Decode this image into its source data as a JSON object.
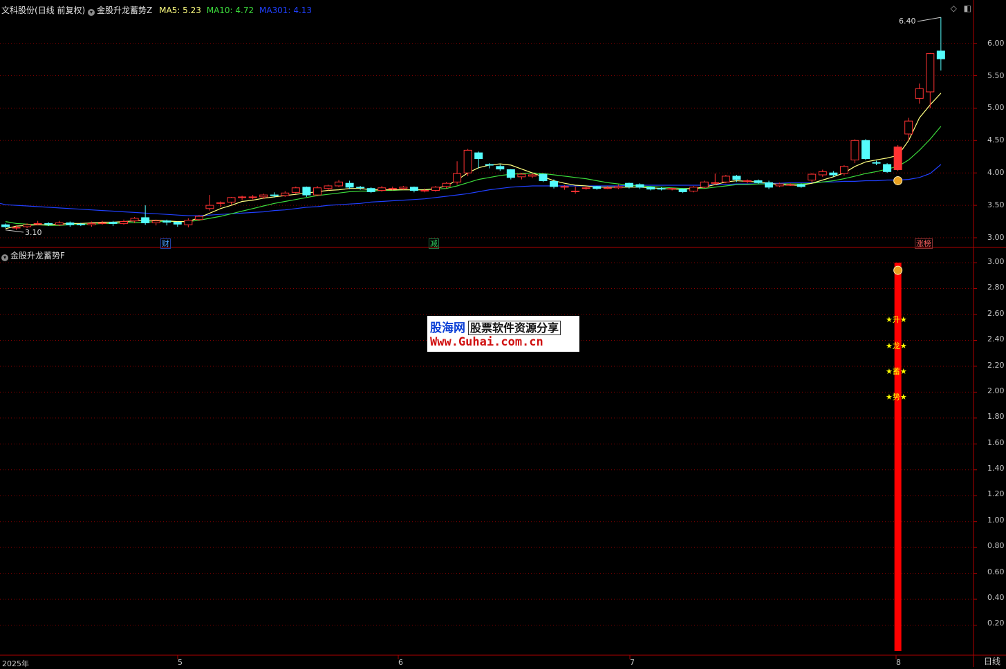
{
  "header": {
    "stock": "文科股份",
    "period": "(日线 前复权)",
    "indicator_main": "金股升龙蓄势Z",
    "ma5_label": "MA5:",
    "ma5_value": "5.23",
    "ma10_label": "MA10:",
    "ma10_value": "4.72",
    "ma301_label": "MA301:",
    "ma301_value": "4.13"
  },
  "sub_header": {
    "indicator_sub": "金股升龙蓄势F"
  },
  "colors": {
    "up": "#ff3232",
    "down": "#54fcfc",
    "ma5": "#ffff80",
    "ma10": "#3cdc3c",
    "ma301": "#2040ff",
    "grid": "#8b0000",
    "axis": "#b00000",
    "bar": "#ff0000"
  },
  "icons": {
    "dropdown": "chevron-down-icon",
    "money_bag": "money-bag-icon",
    "diamond": "diamond-icon",
    "panel": "panel-toggle-icon"
  },
  "y_axis_top": [
    "6.00",
    "5.50",
    "5.00",
    "4.50",
    "4.00",
    "3.50",
    "3.00"
  ],
  "y_axis_bottom": [
    "3.00",
    "2.80",
    "2.60",
    "2.40",
    "2.20",
    "2.00",
    "1.80",
    "1.60",
    "1.40",
    "1.20",
    "1.00",
    "0.80",
    "0.60",
    "0.40",
    "0.20"
  ],
  "x_axis": [
    "2025年",
    "5",
    "6",
    "7",
    "8"
  ],
  "annotations": {
    "high": "6.40",
    "low": "3.10"
  },
  "events": [
    {
      "text": "财",
      "color": "#4aa0ff"
    },
    {
      "text": "减",
      "color": "#30d060"
    },
    {
      "text": "涨榜",
      "color": "#ff6060"
    }
  ],
  "star_labels": [
    "★升★",
    "★龙★",
    "★蓄★",
    "★势★"
  ],
  "watermark": {
    "brand": "股海网",
    "slogan": "股票软件资源分享",
    "url": "Www.Guhai.com.cn"
  },
  "period_label": "日线",
  "chart_data": {
    "type": "candlestick",
    "ylim": [
      2.95,
      6.55
    ],
    "candles": [
      [
        3.2,
        3.17,
        3.22,
        3.15
      ],
      [
        3.15,
        3.16,
        3.19,
        3.12
      ],
      [
        3.17,
        3.2,
        3.22,
        3.15
      ],
      [
        3.21,
        3.22,
        3.26,
        3.19
      ],
      [
        3.22,
        3.21,
        3.24,
        3.18
      ],
      [
        3.2,
        3.23,
        3.26,
        3.18
      ],
      [
        3.23,
        3.2,
        3.25,
        3.17
      ],
      [
        3.21,
        3.2,
        3.23,
        3.18
      ],
      [
        3.2,
        3.22,
        3.25,
        3.17
      ],
      [
        3.22,
        3.23,
        3.26,
        3.2
      ],
      [
        3.24,
        3.22,
        3.26,
        3.18
      ],
      [
        3.22,
        3.25,
        3.28,
        3.2
      ],
      [
        3.26,
        3.3,
        3.32,
        3.23
      ],
      [
        3.31,
        3.23,
        3.5,
        3.2
      ],
      [
        3.23,
        3.26,
        3.28,
        3.19
      ],
      [
        3.26,
        3.24,
        3.28,
        3.19
      ],
      [
        3.24,
        3.21,
        3.25,
        3.17
      ],
      [
        3.2,
        3.27,
        3.3,
        3.16
      ],
      [
        3.28,
        3.33,
        3.35,
        3.26
      ],
      [
        3.45,
        3.5,
        3.66,
        3.42
      ],
      [
        3.53,
        3.54,
        3.56,
        3.47
      ],
      [
        3.55,
        3.62,
        3.63,
        3.51
      ],
      [
        3.62,
        3.63,
        3.65,
        3.58
      ],
      [
        3.63,
        3.63,
        3.66,
        3.59
      ],
      [
        3.63,
        3.66,
        3.68,
        3.6
      ],
      [
        3.66,
        3.65,
        3.7,
        3.62
      ],
      [
        3.65,
        3.69,
        3.72,
        3.63
      ],
      [
        3.7,
        3.77,
        3.79,
        3.68
      ],
      [
        3.78,
        3.66,
        3.79,
        3.63
      ],
      [
        3.66,
        3.77,
        3.8,
        3.64
      ],
      [
        3.76,
        3.8,
        3.82,
        3.73
      ],
      [
        3.8,
        3.86,
        3.89,
        3.78
      ],
      [
        3.84,
        3.78,
        3.88,
        3.75
      ],
      [
        3.78,
        3.77,
        3.8,
        3.74
      ],
      [
        3.76,
        3.71,
        3.78,
        3.69
      ],
      [
        3.73,
        3.77,
        3.8,
        3.71
      ],
      [
        3.76,
        3.76,
        3.79,
        3.73
      ],
      [
        3.76,
        3.78,
        3.8,
        3.74
      ],
      [
        3.78,
        3.73,
        3.79,
        3.7
      ],
      [
        3.72,
        3.73,
        3.76,
        3.7
      ],
      [
        3.73,
        3.78,
        3.8,
        3.71
      ],
      [
        3.79,
        3.84,
        3.86,
        3.76
      ],
      [
        3.86,
        3.99,
        4.18,
        3.82
      ],
      [
        4.0,
        4.35,
        4.37,
        3.95
      ],
      [
        4.31,
        4.22,
        4.33,
        4.07
      ],
      [
        4.13,
        4.12,
        4.15,
        4.07
      ],
      [
        4.1,
        4.06,
        4.13,
        4.03
      ],
      [
        4.05,
        3.93,
        4.06,
        3.9
      ],
      [
        3.94,
        3.98,
        4.0,
        3.9
      ],
      [
        3.95,
        3.97,
        3.99,
        3.92
      ],
      [
        3.98,
        3.88,
        3.99,
        3.86
      ],
      [
        3.87,
        3.79,
        3.9,
        3.76
      ],
      [
        3.79,
        3.79,
        3.81,
        3.74
      ],
      [
        3.71,
        3.72,
        3.79,
        3.68
      ],
      [
        3.76,
        3.77,
        3.8,
        3.74
      ],
      [
        3.79,
        3.76,
        3.8,
        3.74
      ],
      [
        3.77,
        3.77,
        3.8,
        3.75
      ],
      [
        3.77,
        3.79,
        3.82,
        3.75
      ],
      [
        3.84,
        3.79,
        3.85,
        3.76
      ],
      [
        3.82,
        3.78,
        3.84,
        3.75
      ],
      [
        3.78,
        3.75,
        3.79,
        3.73
      ],
      [
        3.76,
        3.75,
        3.78,
        3.73
      ],
      [
        3.75,
        3.76,
        3.77,
        3.73
      ],
      [
        3.75,
        3.71,
        3.76,
        3.69
      ],
      [
        3.72,
        3.78,
        3.8,
        3.7
      ],
      [
        3.78,
        3.86,
        3.88,
        3.76
      ],
      [
        3.84,
        3.85,
        3.99,
        3.82
      ],
      [
        3.86,
        3.95,
        3.97,
        3.84
      ],
      [
        3.95,
        3.9,
        3.97,
        3.86
      ],
      [
        3.87,
        3.88,
        3.9,
        3.84
      ],
      [
        3.88,
        3.85,
        3.9,
        3.83
      ],
      [
        3.85,
        3.78,
        3.88,
        3.75
      ],
      [
        3.8,
        3.83,
        3.85,
        3.78
      ],
      [
        3.82,
        3.82,
        3.84,
        3.8
      ],
      [
        3.82,
        3.79,
        3.84,
        3.77
      ],
      [
        3.89,
        3.98,
        4.0,
        3.85
      ],
      [
        3.97,
        4.02,
        4.05,
        3.94
      ],
      [
        4.0,
        3.97,
        4.03,
        3.94
      ],
      [
        3.99,
        4.1,
        4.12,
        3.96
      ],
      [
        4.2,
        4.5,
        4.52,
        4.15
      ],
      [
        4.5,
        4.22,
        4.52,
        4.2
      ],
      [
        4.16,
        4.15,
        4.19,
        4.12
      ],
      [
        4.13,
        4.02,
        4.15,
        4.0
      ],
      [
        4.05,
        4.4,
        4.43,
        4.03
      ],
      [
        4.6,
        4.8,
        4.85,
        4.5
      ],
      [
        5.15,
        5.3,
        5.38,
        5.07
      ],
      [
        5.25,
        5.84,
        5.85,
        5.0
      ],
      [
        5.88,
        5.76,
        6.4,
        5.58
      ]
    ],
    "ma5": [
      3.14,
      3.18,
      3.19,
      3.2,
      3.2,
      3.21,
      3.22,
      3.22,
      3.23,
      3.24,
      3.24,
      3.25,
      3.26,
      3.27,
      3.27,
      3.26,
      3.25,
      3.25,
      3.31,
      3.38,
      3.45,
      3.5,
      3.56,
      3.58,
      3.61,
      3.63,
      3.65,
      3.67,
      3.69,
      3.71,
      3.73,
      3.74,
      3.76,
      3.76,
      3.74,
      3.74,
      3.74,
      3.74,
      3.74,
      3.74,
      3.76,
      3.8,
      3.89,
      4.0,
      4.08,
      4.12,
      4.14,
      4.12,
      4.06,
      4.0,
      3.94,
      3.88,
      3.84,
      3.81,
      3.8,
      3.78,
      3.78,
      3.78,
      3.78,
      3.78,
      3.77,
      3.76,
      3.75,
      3.75,
      3.76,
      3.78,
      3.82,
      3.86,
      3.88,
      3.87,
      3.86,
      3.84,
      3.82,
      3.81,
      3.81,
      3.84,
      3.89,
      3.94,
      4.0,
      4.1,
      4.17,
      4.2,
      4.23,
      4.27,
      4.5,
      4.85,
      5.05,
      5.23
    ],
    "ma10": [
      3.25,
      3.22,
      3.21,
      3.2,
      3.19,
      3.19,
      3.2,
      3.21,
      3.21,
      3.22,
      3.22,
      3.23,
      3.23,
      3.24,
      3.25,
      3.25,
      3.25,
      3.25,
      3.27,
      3.3,
      3.33,
      3.37,
      3.41,
      3.45,
      3.49,
      3.53,
      3.56,
      3.59,
      3.62,
      3.65,
      3.67,
      3.69,
      3.71,
      3.72,
      3.72,
      3.73,
      3.73,
      3.74,
      3.74,
      3.74,
      3.75,
      3.76,
      3.8,
      3.85,
      3.9,
      3.93,
      3.96,
      3.98,
      3.99,
      4.0,
      3.99,
      3.97,
      3.95,
      3.93,
      3.91,
      3.88,
      3.85,
      3.83,
      3.81,
      3.8,
      3.79,
      3.78,
      3.77,
      3.76,
      3.76,
      3.76,
      3.78,
      3.8,
      3.82,
      3.82,
      3.83,
      3.83,
      3.83,
      3.83,
      3.83,
      3.84,
      3.86,
      3.88,
      3.91,
      3.95,
      3.99,
      4.02,
      4.06,
      4.1,
      4.2,
      4.35,
      4.52,
      4.72
    ],
    "ma301": [
      3.51,
      3.5,
      3.49,
      3.48,
      3.47,
      3.46,
      3.45,
      3.44,
      3.43,
      3.42,
      3.41,
      3.4,
      3.39,
      3.38,
      3.37,
      3.36,
      3.35,
      3.34,
      3.34,
      3.35,
      3.36,
      3.37,
      3.38,
      3.39,
      3.4,
      3.42,
      3.43,
      3.45,
      3.47,
      3.48,
      3.5,
      3.51,
      3.52,
      3.53,
      3.55,
      3.56,
      3.57,
      3.58,
      3.59,
      3.6,
      3.62,
      3.64,
      3.66,
      3.68,
      3.71,
      3.74,
      3.76,
      3.78,
      3.79,
      3.8,
      3.8,
      3.8,
      3.8,
      3.8,
      3.8,
      3.8,
      3.8,
      3.8,
      3.81,
      3.81,
      3.81,
      3.81,
      3.81,
      3.81,
      3.81,
      3.81,
      3.82,
      3.82,
      3.83,
      3.83,
      3.83,
      3.84,
      3.84,
      3.85,
      3.85,
      3.85,
      3.86,
      3.86,
      3.87,
      3.87,
      3.88,
      3.88,
      3.89,
      3.89,
      3.9,
      3.93,
      3.99,
      4.13
    ],
    "signal_bar": {
      "index": 83,
      "value": 3.0,
      "ylim": [
        0,
        3.05
      ]
    }
  }
}
